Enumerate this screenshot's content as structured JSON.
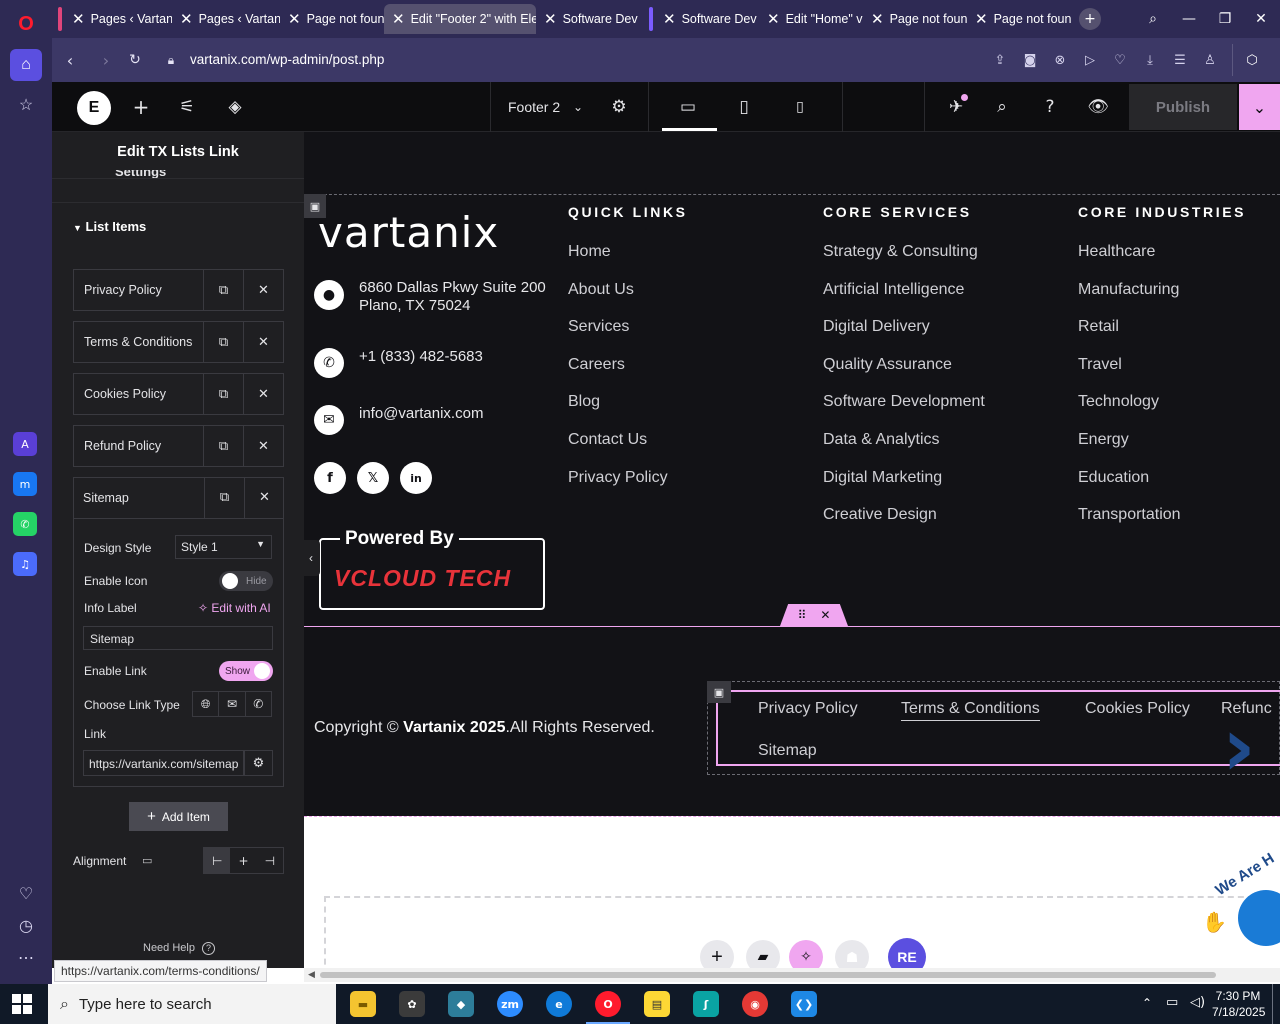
{
  "browser": {
    "tabs": [
      {
        "title": "Pages ‹ Vartan"
      },
      {
        "title": "Pages ‹ Vartan"
      },
      {
        "title": "Page not foun"
      },
      {
        "title": "Edit \"Footer 2\" with Ele"
      },
      {
        "title": "Software Dev"
      },
      {
        "title": "Software Dev"
      },
      {
        "title": "Edit \"Home\" v"
      },
      {
        "title": "Page not foun"
      },
      {
        "title": "Page not foun"
      }
    ],
    "url": "vartanix.com/wp-admin/post.php",
    "new_tab_icon": "plus-icon"
  },
  "elementor": {
    "template_name": "Footer 2",
    "publish_label": "Publish",
    "panel": {
      "title": "Edit TX Lists Link",
      "settings_fragment": "Settings",
      "section_title": "List Items",
      "items": [
        {
          "label": "Privacy Policy"
        },
        {
          "label": "Terms & Conditions"
        },
        {
          "label": "Cookies Policy"
        },
        {
          "label": "Refund Policy"
        },
        {
          "label": "Sitemap"
        }
      ],
      "design_style_label": "Design Style",
      "design_style_value": "Style 1",
      "enable_icon_label": "Enable Icon",
      "enable_icon_state": "Hide",
      "info_label_label": "Info Label",
      "edit_with_ai": "Edit with AI",
      "info_label_value": "Sitemap",
      "enable_link_label": "Enable Link",
      "enable_link_state": "Show",
      "link_type_label": "Choose Link Type",
      "link_label": "Link",
      "link_value": "https://vartanix.com/sitemap",
      "add_item_label": "Add Item",
      "alignment_label": "Alignment",
      "need_help": "Need Help"
    }
  },
  "footer": {
    "logo_text": "vartanix",
    "address_line1": "6860 Dallas Pkwy Suite 200",
    "address_line2": "Plano, TX 75024",
    "phone": "+1 (833) 482-5683",
    "email": "info@vartanix.com",
    "powered_by": "Powered By",
    "powered_logo": "VCLOUD TECH",
    "quick_links": {
      "heading": "QUICK LINKS",
      "items": [
        "Home",
        "About Us",
        "Services",
        "Careers",
        "Blog",
        "Contact Us",
        "Privacy Policy"
      ]
    },
    "core_services": {
      "heading": "CORE SERVICES",
      "items": [
        "Strategy & Consulting",
        "Artificial Intelligence",
        "Digital Delivery",
        "Quality Assurance",
        "Software Development",
        "Data & Analytics",
        "Digital Marketing",
        "Creative Design"
      ]
    },
    "core_industries": {
      "heading": "CORE INDUSTRIES",
      "items": [
        "Healthcare",
        "Manufacturing",
        "Retail",
        "Travel",
        "Technology",
        "Energy",
        "Education",
        "Transportation"
      ]
    },
    "copyright_prefix": "Copyright ©",
    "copyright_brand": "Vartanix 2025",
    "copyright_suffix": ".All Rights Reserved.",
    "bottom_links": [
      "Privacy Policy",
      "Terms & Conditions",
      "Cookies Policy",
      "Refunc",
      "Sitemap"
    ],
    "badge_text": "We Are H"
  },
  "status_url": "https://vartanix.com/terms-conditions/",
  "taskbar": {
    "search_placeholder": "Type here to search",
    "time": "7:30 PM",
    "date": "7/18/2025"
  },
  "colors": {
    "accent_pink": "#f0a6f0",
    "footer_bg": "#121216",
    "opera_bg": "#2e2a54"
  }
}
